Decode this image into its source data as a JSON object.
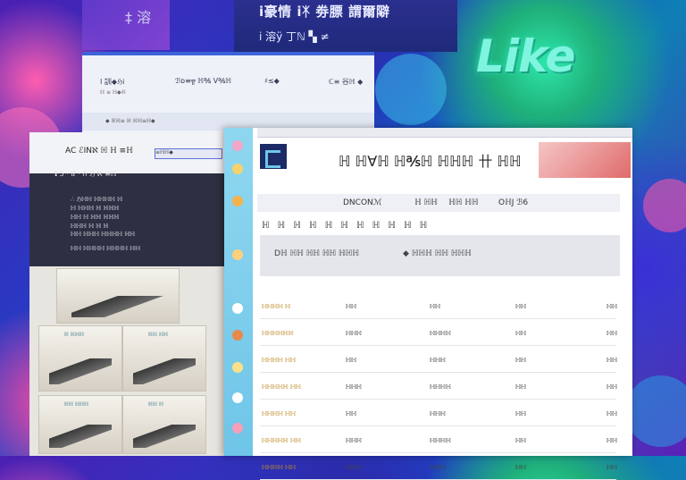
{
  "banner": {
    "line1": "ⅰ豪情 ⅰᛡ 劵膘 謂爾隦",
    "line2": "ⅰ 溶ÿ 丁ℕ ▚ ≠"
  },
  "topleft_glyph": "‡ 溶",
  "logo_text": "Like",
  "mid_window": {
    "brand": "Ⅰ 訓◆ℌⅰ",
    "nav_1": "ℬᴅ≡╦ ℍ℁ Ⅴ℁ℍ",
    "nav_2": "♯≤◆",
    "nav_3": "ℂ≡ 谷ℍ ◆",
    "sub": "ℍ ≡ ℍ◆ℍ",
    "foot": "◆ ℍℍ≡ ℍ ℍℍ≡ℍ◆"
  },
  "dark_window": {
    "title": "AC ℰⅠNℵ ℍ ℍ ≡ℍ",
    "search_placeholder": "≡ℍℍ◆",
    "heading": "ℹ 5 · lℓ · ℎ ℌ ℵ ≡ℍ",
    "lines": [
      "∴ ℌℍℍ ℍℍℍℍ ℍ",
      "ℍ ℍℍℍ ℍ ℍℍℍ",
      "ℍℍ ℍ ℍℍ ℍℍℍ",
      "ℍℍℍ ℍ ℍ ℍ"
    ],
    "foot1": "ℍℍ ℍℍℍ ℍℍℍℍ ℍℍ",
    "foot2": "ℍℍ ℍℍℍℍ ℍℍℍℍ ℍℍ",
    "thumb_labels": [
      "ℍ ℍℍℍ",
      "ℍℍ ℍℍ",
      "ℍℍ ℍℍℍ",
      "ℍℍ ℍ"
    ]
  },
  "main_window": {
    "title": "ℍ ℍ∀ℍ ℍ℁ℍ ℍℍℍ 卄 ℍℍ",
    "tabs": [
      "DNCONℳ",
      "ℍ ℍℍ",
      "ℍℍ ℍℍ",
      "OℍJ ℬ6"
    ],
    "chars": "ℍ ℍ ℍ ℍ ℍ ℍ ℍ ℍ ℍ ℍ ℍ",
    "panel_left": "Dℍ ℍℍ ℍℍ ℍℍ ℍℍℍ",
    "panel_right": "◆ ℍℍℍ ℍℍ ℍℍℍ",
    "rows": [
      [
        "ℍℍℍℍ ℍ",
        "ℍℍ",
        "ℍℍ",
        "ℍℍ",
        "ℍℍ"
      ],
      [
        "ℍℍℍℍℍℍ",
        "ℍℍℍ",
        "ℍℍℍℍ",
        "ℍℍ",
        "ℍℍ"
      ],
      [
        "ℍℍℍℍ ℍℍ",
        "ℍℍ",
        "ℍℍℍ",
        "ℍℍ",
        "ℍℍ"
      ],
      [
        "ℍℍℍℍℍ ℍℍ",
        "ℍℍℍ",
        "ℍℍℍℍ",
        "ℍℍ",
        "ℍℍ"
      ],
      [
        "ℍℍℍℍ ℍℍ",
        "ℍℍ",
        "ℍℍℍ",
        "ℍℍ",
        "ℍℍ"
      ],
      [
        "ℍℍℍℍℍ ℍℍ",
        "ℍℍℍ",
        "ℍℍℍℍ",
        "ℍℍ",
        "ℍℍ"
      ],
      [
        "ℍℍℍℍ ℍℍ",
        "ℍℍℍ",
        "ℍℍℍ",
        "ℍℍ",
        "ℍℍ"
      ]
    ]
  },
  "colors": {
    "accent": "#3d63d8",
    "logo": "#7ff5e0",
    "sidebar": "#8fd7f0",
    "gold_text": "#c08a2a"
  }
}
